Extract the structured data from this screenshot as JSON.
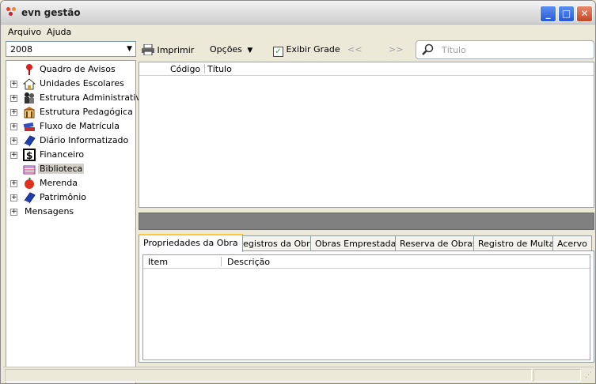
{
  "window": {
    "title": "evn gestão",
    "minimize": "_",
    "maximize": "□",
    "close": "✕"
  },
  "menu": {
    "items": [
      "Arquivo",
      "Ajuda"
    ]
  },
  "year_select": {
    "value": "2008"
  },
  "tree": {
    "items": [
      {
        "label": "Quadro de Avisos",
        "icon": "pin-icon",
        "expandable": false
      },
      {
        "label": "Unidades Escolares",
        "icon": "house-icon",
        "expandable": true
      },
      {
        "label": "Estrutura Administrativa",
        "icon": "people-icon",
        "expandable": true
      },
      {
        "label": "Estrutura Pedagógica",
        "icon": "building-icon",
        "expandable": true
      },
      {
        "label": "Fluxo de Matrícula",
        "icon": "books-icon",
        "expandable": true
      },
      {
        "label": "Diário Informatizado",
        "icon": "book-icon",
        "expandable": true
      },
      {
        "label": "Financeiro",
        "icon": "dollar-icon",
        "expandable": true
      },
      {
        "label": "Biblioteca",
        "icon": "library-icon",
        "expandable": false,
        "selected": true
      },
      {
        "label": "Merenda",
        "icon": "apple-icon",
        "expandable": true
      },
      {
        "label": "Patrimônio",
        "icon": "book-icon",
        "expandable": true
      },
      {
        "label": "Mensagens",
        "icon": "",
        "expandable": true
      }
    ]
  },
  "toolbar": {
    "print_label": "Imprimir",
    "options_label": "Opções",
    "show_grid_label": "Exibir Grade",
    "show_grid_checked": true,
    "prev_label": "<<",
    "next_label": ">>",
    "search_placeholder": "Título"
  },
  "grid": {
    "columns": [
      "Código",
      "Título"
    ]
  },
  "tabs": {
    "items": [
      "Propriedades da Obra",
      "Registros da Obra",
      "Obras Emprestadas",
      "Reserva de Obras",
      "Registro de Multas",
      "Acervo"
    ],
    "active": 0
  },
  "sub_grid": {
    "columns": [
      "Item",
      "Descrição"
    ]
  }
}
